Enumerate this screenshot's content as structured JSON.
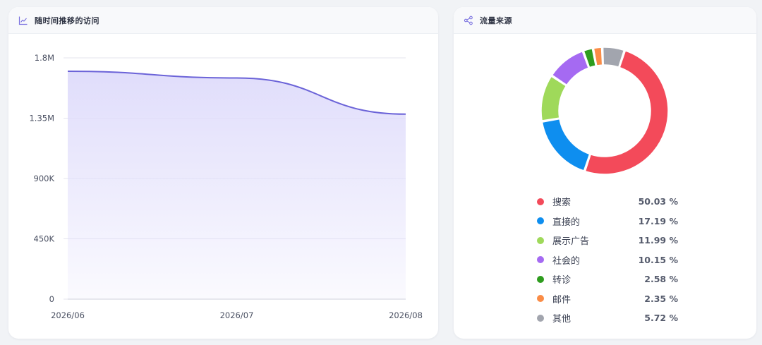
{
  "left_panel": {
    "title": "随时间推移的访问",
    "icon": "line-chart-icon"
  },
  "right_panel": {
    "title": "流量来源",
    "icon": "share-icon"
  },
  "colors": {
    "line": "#6b63d8",
    "area": "#e0ddfb",
    "grid": "#e4e4ee"
  },
  "chart_data": [
    {
      "type": "area",
      "x": [
        "2026/06",
        "2026/07",
        "2026/08"
      ],
      "y_tick_labels": [
        "0",
        "450K",
        "900K",
        "1.35M",
        "1.8M"
      ],
      "ylim": [
        0,
        1800000
      ],
      "series": [
        {
          "values": [
            1700000,
            1650000,
            1380000
          ]
        }
      ],
      "grid": true
    },
    {
      "type": "pie",
      "donut": true,
      "slices": [
        {
          "label": "搜索",
          "value": 50.03,
          "display": "50.03 %",
          "color": "#f34a5a"
        },
        {
          "label": "直接的",
          "value": 17.19,
          "display": "17.19 %",
          "color": "#0e8eef"
        },
        {
          "label": "展示广告",
          "value": 11.99,
          "display": "11.99 %",
          "color": "#9fd95a"
        },
        {
          "label": "社会的",
          "value": 10.15,
          "display": "10.15 %",
          "color": "#a56af2"
        },
        {
          "label": "转诊",
          "value": 2.58,
          "display": "2.58 %",
          "color": "#2e9c1e"
        },
        {
          "label": "邮件",
          "value": 2.35,
          "display": "2.35 %",
          "color": "#fa8c46"
        },
        {
          "label": "其他",
          "value": 5.72,
          "display": "5.72 %",
          "color": "#a2a5ae"
        }
      ],
      "legend_position": "bottom"
    }
  ]
}
